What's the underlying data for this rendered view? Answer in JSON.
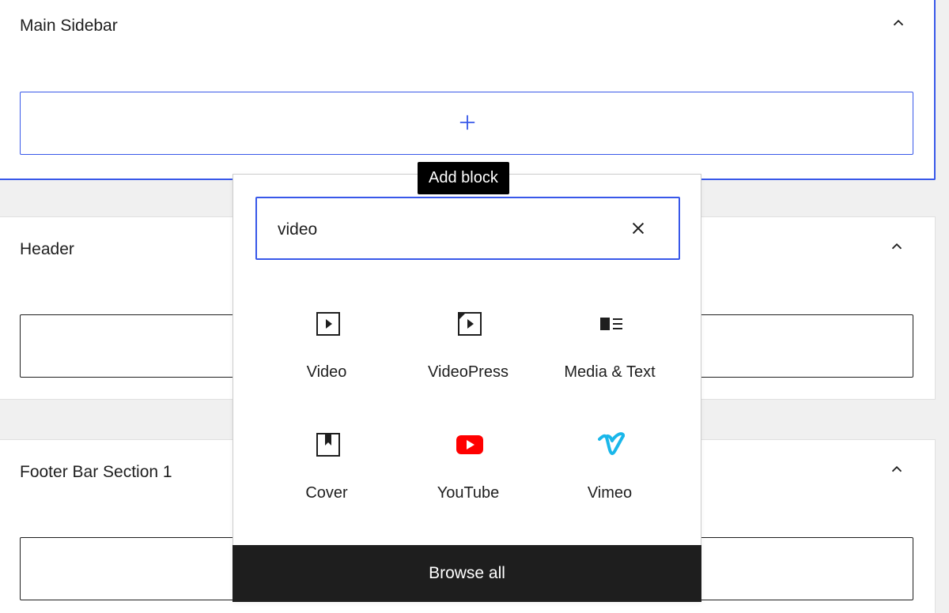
{
  "areas": {
    "main_sidebar": {
      "title": "Main Sidebar"
    },
    "header": {
      "title": "Header"
    },
    "footer_bar_section_1": {
      "title": "Footer Bar Section 1"
    }
  },
  "inserter": {
    "tooltip": "Add block",
    "search": {
      "value": "video"
    },
    "blocks": [
      {
        "label": "Video",
        "icon": "video-icon"
      },
      {
        "label": "VideoPress",
        "icon": "videopress-icon"
      },
      {
        "label": "Media & Text",
        "icon": "media-text-icon"
      },
      {
        "label": "Cover",
        "icon": "cover-icon"
      },
      {
        "label": "YouTube",
        "icon": "youtube-icon"
      },
      {
        "label": "Vimeo",
        "icon": "vimeo-icon"
      }
    ],
    "browse_all": "Browse all"
  },
  "colors": {
    "accent": "#3858e9",
    "youtube": "#ff0000",
    "vimeo": "#1ab7ea",
    "dark": "#1e1e1e"
  }
}
